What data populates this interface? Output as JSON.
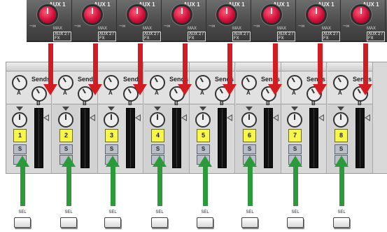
{
  "hardware": {
    "units": [
      {
        "aux": "AUX 1",
        "min": "−∞",
        "max": "MAX",
        "fx": "AUX 2 / FX"
      },
      {
        "aux": "AUX 1",
        "min": "−∞",
        "max": "MAX",
        "fx": "AUX 2 / FX"
      },
      {
        "aux": "AUX 1",
        "min": "−∞",
        "max": "MAX",
        "fx": "AUX 2 / FX"
      },
      {
        "aux": "AUX 1",
        "min": "−∞",
        "max": "MAX",
        "fx": "AUX 2 / FX"
      },
      {
        "aux": "AUX 1",
        "min": "−∞",
        "max": "MAX",
        "fx": "AUX 2 / FX"
      },
      {
        "aux": "AUX 1",
        "min": "−∞",
        "max": "MAX",
        "fx": "AUX 2 / FX"
      },
      {
        "aux": "AUX 1",
        "min": "−∞",
        "max": "MAX",
        "fx": "AUX 2 / FX"
      },
      {
        "aux": "AUX 1",
        "min": "−∞",
        "max": "MAX",
        "fx": "AUX 2 / FX"
      }
    ],
    "sel_buttons": [
      {
        "label": "SEL"
      },
      {
        "label": "SEL"
      },
      {
        "label": "SEL"
      },
      {
        "label": "SEL"
      },
      {
        "label": "SEL"
      },
      {
        "label": "SEL"
      },
      {
        "label": "SEL"
      },
      {
        "label": "SEL"
      }
    ]
  },
  "mixer": {
    "channels": [
      {
        "sends_label": "Sends",
        "send_a": "A",
        "send_b": "B",
        "number": "1",
        "solo": "S"
      },
      {
        "sends_label": "Sends",
        "send_a": "A",
        "send_b": "B",
        "number": "2",
        "solo": "S"
      },
      {
        "sends_label": "Sends",
        "send_a": "A",
        "send_b": "B",
        "number": "3",
        "solo": "S"
      },
      {
        "sends_label": "Sends",
        "send_a": "A",
        "send_b": "B",
        "number": "4",
        "solo": "S"
      },
      {
        "sends_label": "Sends",
        "send_a": "A",
        "send_b": "B",
        "number": "5",
        "solo": "S"
      },
      {
        "sends_label": "Sends",
        "send_a": "A",
        "send_b": "B",
        "number": "6",
        "solo": "S"
      },
      {
        "sends_label": "Sends",
        "send_a": "A",
        "send_b": "B",
        "number": "7",
        "solo": "S"
      },
      {
        "sends_label": "Sends",
        "send_a": "A",
        "send_b": "B",
        "number": "8",
        "solo": "S"
      }
    ]
  },
  "colors": {
    "arrow_red": "#d21c24",
    "arrow_green": "#2c9a3a",
    "track_button": "#f8f64a",
    "hardware_knob": "#d0103a"
  },
  "icons": {
    "down_arrow": "red-arrow-down-icon",
    "up_arrow": "green-arrow-up-icon"
  }
}
